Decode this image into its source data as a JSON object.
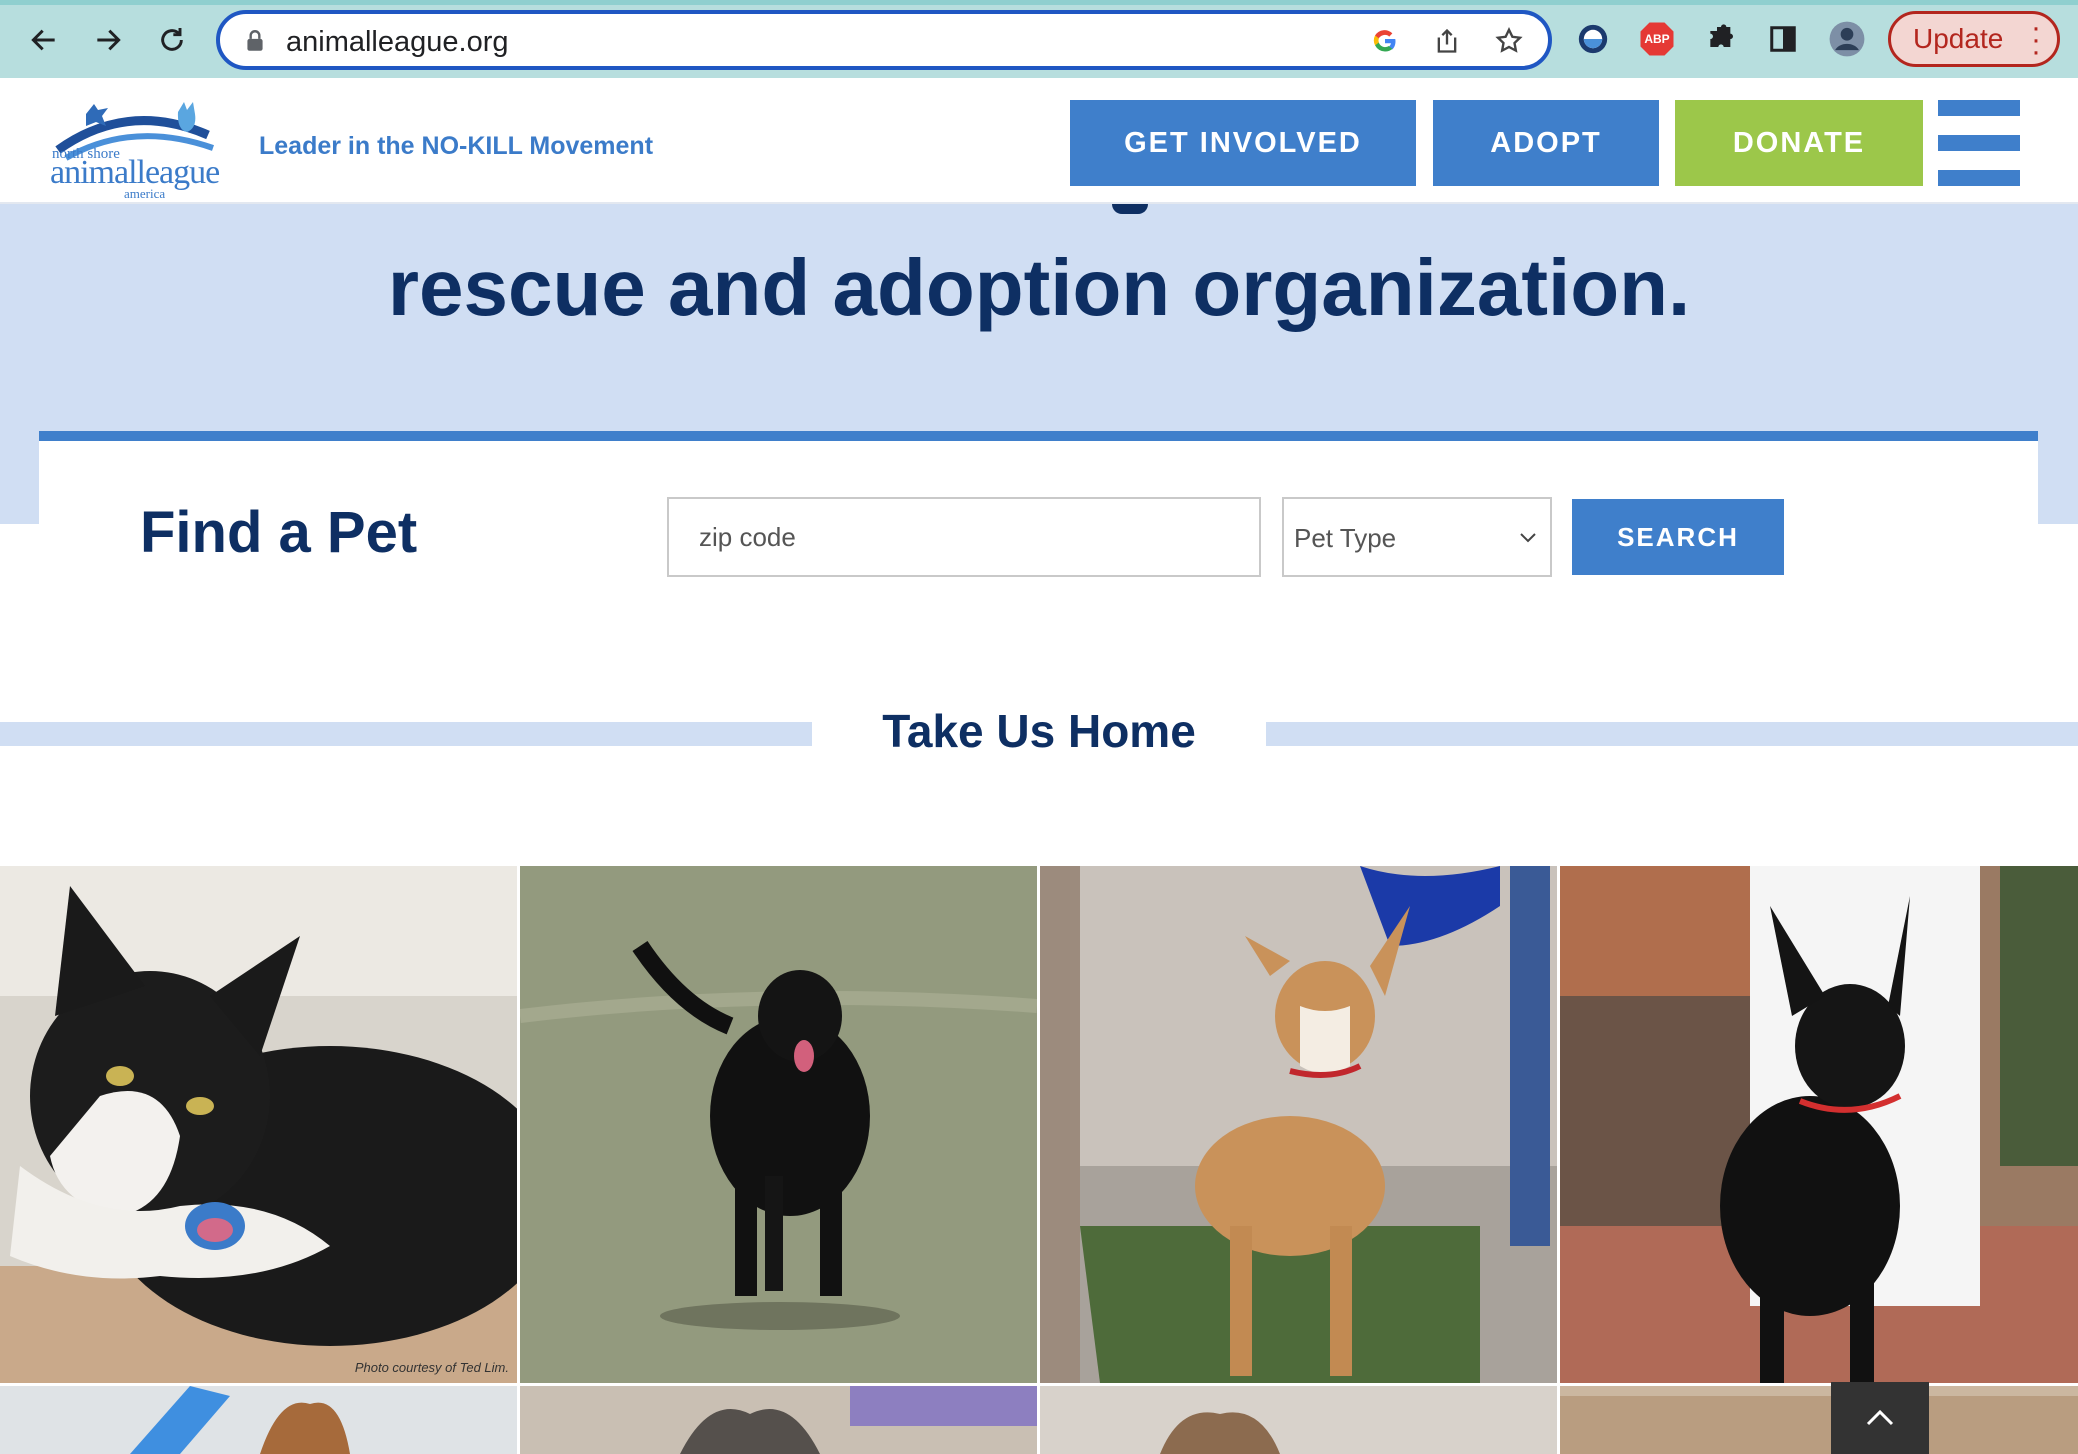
{
  "browser": {
    "url": "animalleague.org",
    "update_label": "Update",
    "abp_label": "ABP"
  },
  "header": {
    "logo_line1": "north shore",
    "logo_line2": "animalleague",
    "logo_line3": "america",
    "tagline": "Leader in the NO-KILL Movement",
    "nav": {
      "get_involved": "GET INVOLVED",
      "adopt": "ADOPT",
      "donate": "DONATE"
    },
    "menu_icon": "hamburger-icon"
  },
  "hero": {
    "title": "rescue and adoption organization."
  },
  "find_pet": {
    "title": "Find a Pet",
    "zip_placeholder": "zip code",
    "pet_type_selected": "Pet Type",
    "search_label": "SEARCH"
  },
  "take_us_home": {
    "title": "Take Us Home",
    "pets": [
      {
        "animal": "tuxedo cat",
        "credit": "Photo courtesy of Ted Lim."
      },
      {
        "animal": "black labrador dog"
      },
      {
        "animal": "tan puppy with red collar"
      },
      {
        "animal": "black shepherd puppy with red collar"
      }
    ]
  },
  "colors": {
    "navy": "#0e2f63",
    "brand_blue": "#3f7fcb",
    "light_blue": "#d0def3",
    "donate_green": "#9cc74a",
    "update_red": "#b3261e"
  }
}
